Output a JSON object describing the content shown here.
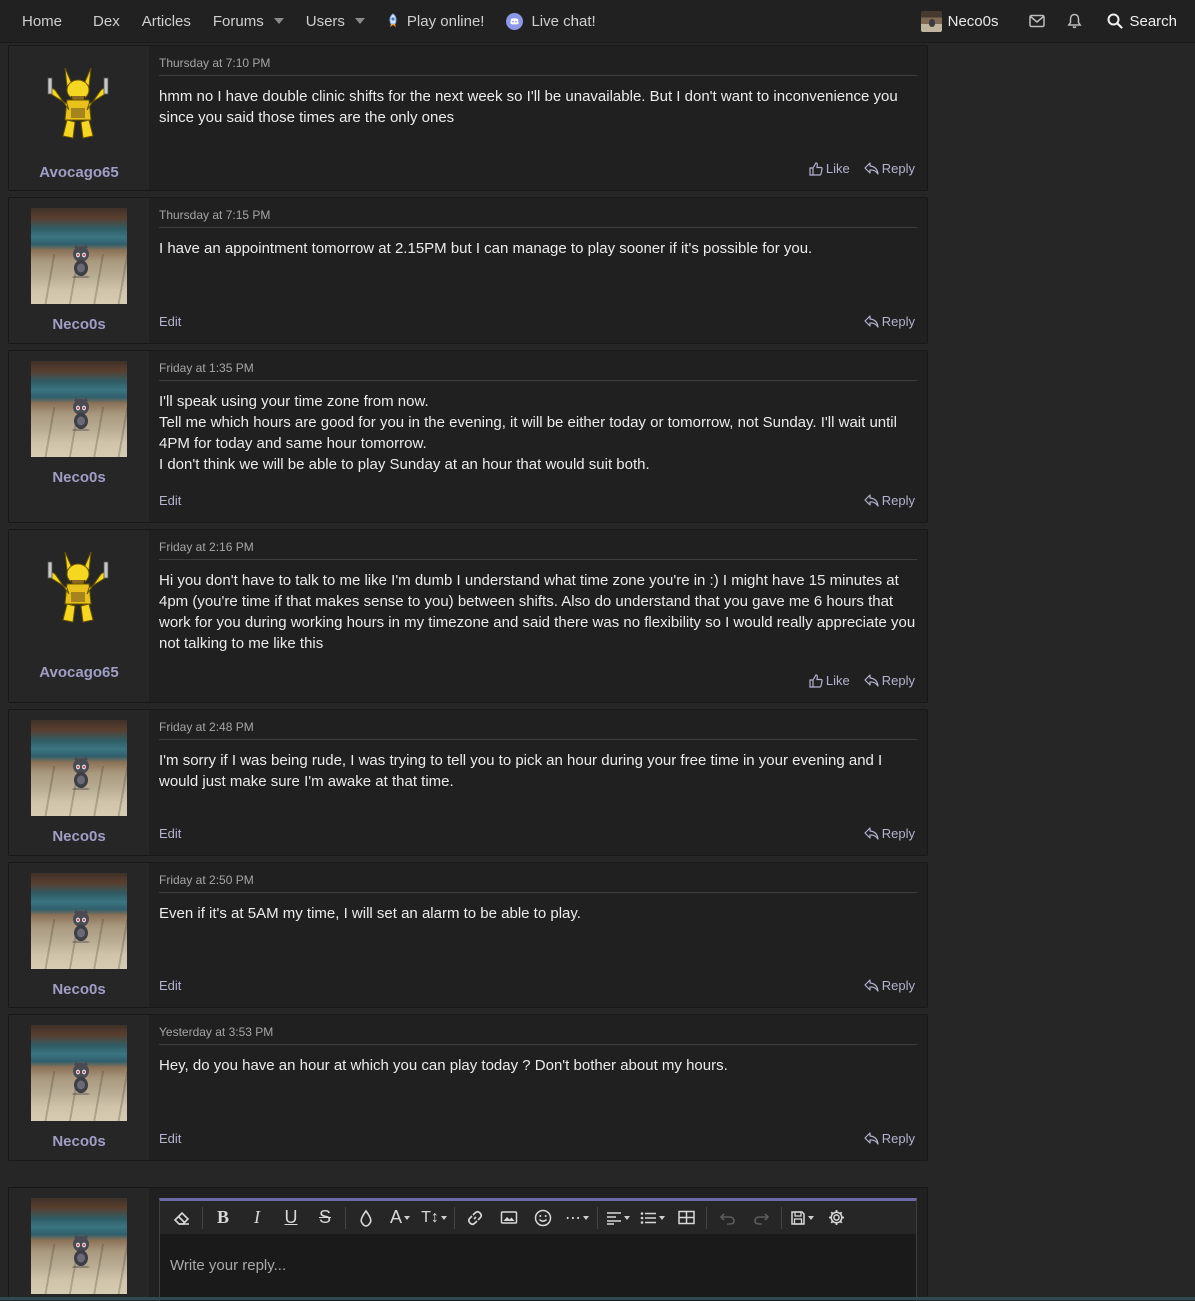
{
  "nav": {
    "items": [
      {
        "label": "Home"
      },
      {
        "label": "Dex"
      },
      {
        "label": "Articles"
      },
      {
        "label": "Forums",
        "dropdown": true
      },
      {
        "label": "Users",
        "dropdown": true
      },
      {
        "label": "Play online!",
        "icon": "rocket-icon"
      },
      {
        "label": "Live chat!",
        "icon": "discord-icon"
      }
    ],
    "username": "Neco0s",
    "search_label": "Search"
  },
  "posts": [
    {
      "author": "Avocago65",
      "avatar": "alakazam",
      "date": "Thursday at 7:10 PM",
      "body": "hmm no I have double clinic shifts for the next week so I'll be unavailable. But I don't want to inconvenience you since you said those times are the only ones",
      "like_label": "Like",
      "reply_label": "Reply",
      "own": false
    },
    {
      "author": "Neco0s",
      "avatar": "neco",
      "date": "Thursday at 7:15 PM",
      "body": "I have an appointment tomorrow at 2.15PM but I can manage to play sooner if it's possible for you.",
      "edit_label": "Edit",
      "reply_label": "Reply",
      "own": true
    },
    {
      "author": "Neco0s",
      "avatar": "neco",
      "date": "Friday at 1:35 PM",
      "body": "I'll speak using your time zone from now.\nTell me which hours are good for you in the evening, it will be either today or tomorrow, not Sunday. I'll wait until 4PM for today and same hour tomorrow.\nI don't think we will be able to play Sunday at an hour that would suit both.",
      "edit_label": "Edit",
      "reply_label": "Reply",
      "own": true
    },
    {
      "author": "Avocago65",
      "avatar": "alakazam",
      "date": "Friday at 2:16 PM",
      "body": "Hi you don't have to talk to me like I'm dumb I understand what time zone you're in :) I might have 15 minutes at 4pm (you're time if that makes sense to you) between shifts. Also do understand that you gave me 6 hours that work for you during working hours in my timezone and said there was no flexibility so I would really appreciate you not talking to me like this",
      "like_label": "Like",
      "reply_label": "Reply",
      "own": false
    },
    {
      "author": "Neco0s",
      "avatar": "neco",
      "date": "Friday at 2:48 PM",
      "body": "I'm sorry if I was being rude, I was trying to tell you to pick an hour during your free time in your evening and I would just make sure I'm awake at that time.",
      "edit_label": "Edit",
      "reply_label": "Reply",
      "own": true
    },
    {
      "author": "Neco0s",
      "avatar": "neco",
      "date": "Friday at 2:50 PM",
      "body": "Even if it's at 5AM my time, I will set an alarm to be able to play.",
      "edit_label": "Edit",
      "reply_label": "Reply",
      "own": true
    },
    {
      "author": "Neco0s",
      "avatar": "neco",
      "date": "Yesterday at 3:53 PM",
      "body": "Hey, do you have an hour at which you can play today ? Don't bother about my hours.",
      "edit_label": "Edit",
      "reply_label": "Reply",
      "own": true
    }
  ],
  "reply": {
    "placeholder": "Write your reply...",
    "toolbar": [
      "eraser-icon",
      "bold-icon",
      "italic-icon",
      "underline-icon",
      "strikethrough-icon",
      "text-color-icon",
      "font-family-icon",
      "font-size-icon",
      "link-icon",
      "image-icon",
      "emoji-icon",
      "more-icon",
      "align-icon",
      "list-icon",
      "table-icon",
      "undo-icon",
      "redo-icon",
      "drafts-icon",
      "settings-icon"
    ]
  },
  "colors": {
    "accent": "#6d6aa6",
    "username": "#a09ec6",
    "link": "#b3b3cf"
  }
}
